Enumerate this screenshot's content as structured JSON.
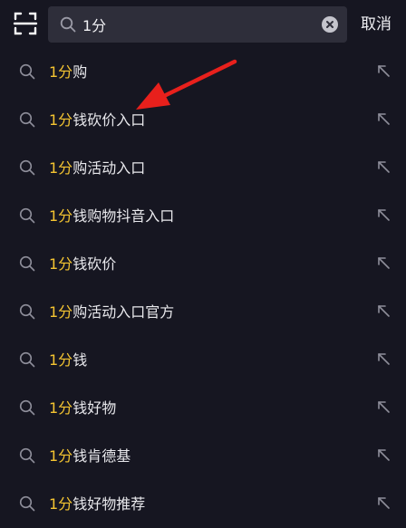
{
  "header": {
    "scan_icon": "scan-icon",
    "search_icon": "search-icon",
    "search_value": "1分",
    "clear_icon": "clear-icon",
    "cancel_label": "取消"
  },
  "suggestions": [
    {
      "highlight": "1分",
      "rest": "购"
    },
    {
      "highlight": "1分",
      "rest": "钱砍价入口"
    },
    {
      "highlight": "1分",
      "rest": "购活动入口"
    },
    {
      "highlight": "1分",
      "rest": "钱购物抖音入口"
    },
    {
      "highlight": "1分",
      "rest": "钱砍价"
    },
    {
      "highlight": "1分",
      "rest": "购活动入口官方"
    },
    {
      "highlight": "1分",
      "rest": "钱"
    },
    {
      "highlight": "1分",
      "rest": "钱好物"
    },
    {
      "highlight": "1分",
      "rest": "钱肯德基"
    },
    {
      "highlight": "1分",
      "rest": "钱好物推荐"
    }
  ],
  "icons": {
    "row_search": "search-icon",
    "row_fill": "arrow-up-left-icon",
    "annotation": "red-arrow-annotation"
  },
  "colors": {
    "background": "#161621",
    "search_box": "#2e2e3a",
    "highlight": "#f5c531",
    "text": "#e8e8ec",
    "annotation": "#e8201c"
  }
}
